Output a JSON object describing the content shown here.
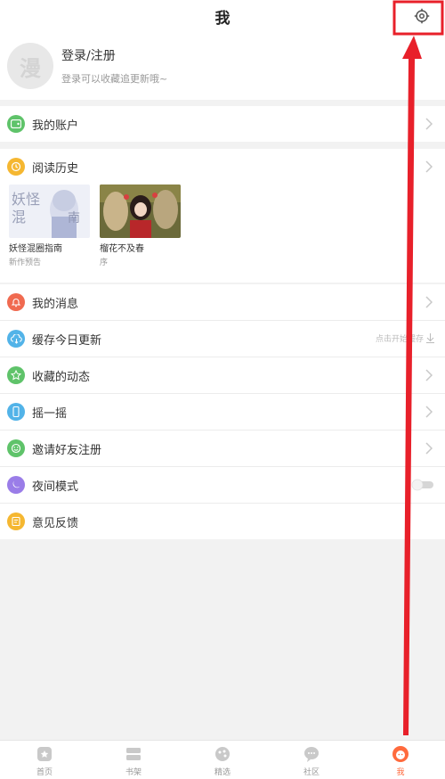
{
  "header": {
    "title": "我"
  },
  "profile": {
    "avatar_char": "漫",
    "login_label": "登录/注册",
    "login_sub": "登录可以收藏追更新哦~"
  },
  "menu": {
    "account": "我的账户",
    "history": "阅读历史",
    "messages": "我的消息",
    "cache": "缓存今日更新",
    "cache_hint": "点击开始缓存",
    "favorites": "收藏的动态",
    "shake": "摇一摇",
    "invite": "邀请好友注册",
    "night": "夜间模式",
    "feedback": "意见反馈"
  },
  "history_items": [
    {
      "title": "妖怪混圈指南",
      "sub": "新作预告"
    },
    {
      "title": "榴花不及春",
      "sub": "序"
    }
  ],
  "tabs": [
    "首页",
    "书架",
    "精选",
    "社区",
    "我"
  ],
  "colors": {
    "accent": "#ff6a3d",
    "annotation_red": "#e8202a",
    "icon_green": "#5fc36a",
    "icon_yellow": "#f5b731",
    "icon_red": "#f06a50",
    "icon_blue": "#52b3e8",
    "icon_purple": "#9a7de8"
  }
}
